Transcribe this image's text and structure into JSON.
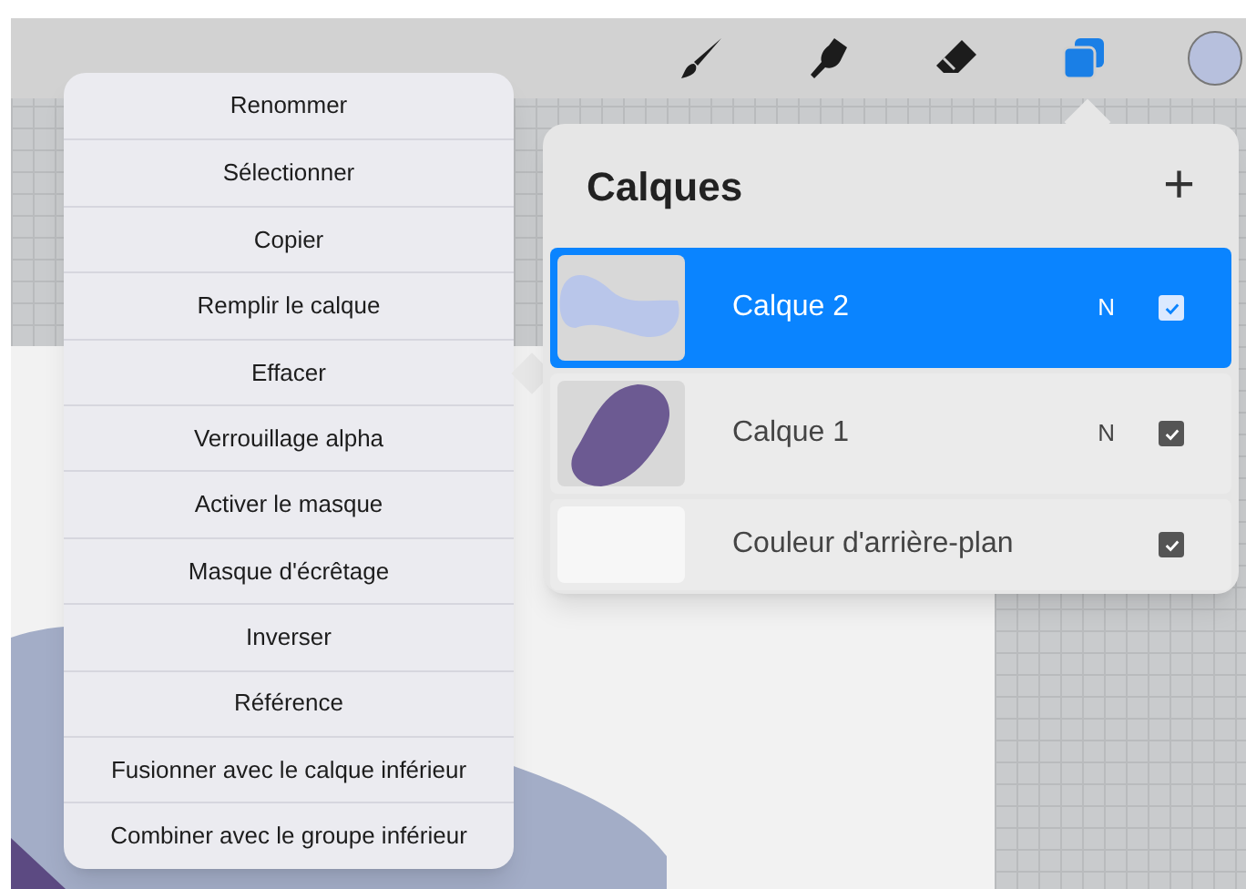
{
  "toolbar": [
    {
      "kind": "brush",
      "selected": false
    },
    {
      "kind": "smudge",
      "selected": false
    },
    {
      "kind": "eraser",
      "selected": false
    },
    {
      "kind": "layers",
      "selected": true
    },
    {
      "kind": "color",
      "selected": false
    }
  ],
  "layer_menu": [
    "Renommer",
    "Sélectionner",
    "Copier",
    "Remplir le calque",
    "Effacer",
    "Verrouillage alpha",
    "Activer le masque",
    "Masque d'écrêtage",
    "Inverser",
    "Référence",
    "Fusionner avec le calque inférieur",
    "Combiner avec le groupe inférieur"
  ],
  "layers_panel": {
    "title": "Calques",
    "add_button": "+",
    "layers": [
      {
        "kind": "layer",
        "name": "Calque 2",
        "blend": "N",
        "visible": true,
        "selected": true
      },
      {
        "kind": "layer",
        "name": "Calque 1",
        "blend": "N",
        "visible": true,
        "selected": false
      },
      {
        "kind": "background",
        "name": "Couleur d'arrière-plan",
        "visible": true,
        "selected": false
      }
    ]
  }
}
